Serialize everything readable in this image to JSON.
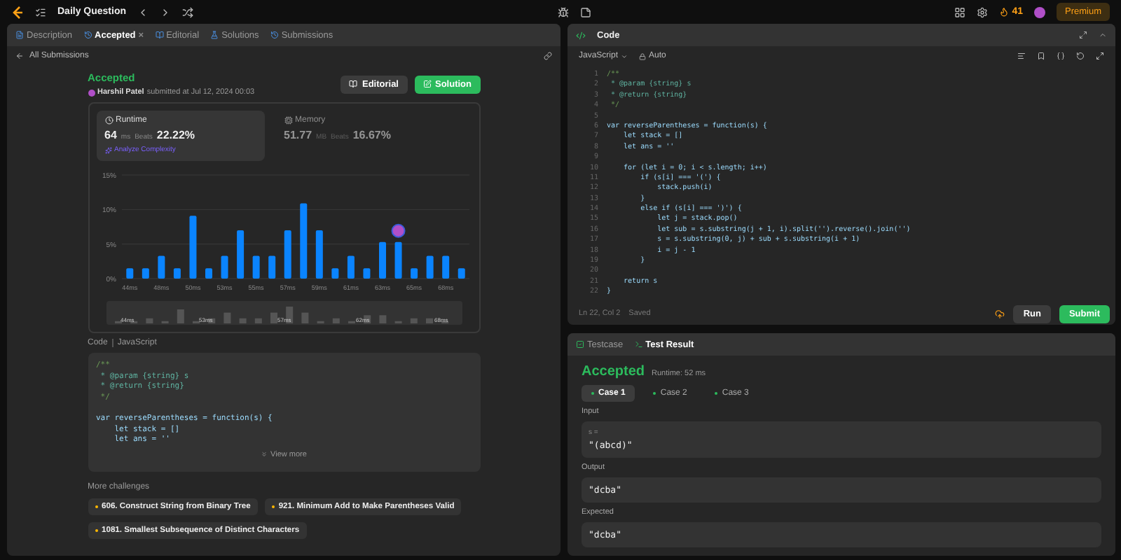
{
  "top_bar": {
    "title": "Daily Question",
    "streak": "41",
    "premium": "Premium"
  },
  "left_tabs": [
    {
      "label": "Description",
      "selected": false,
      "kind": "description"
    },
    {
      "label": "Accepted",
      "selected": true,
      "kind": "accepted",
      "close": "×"
    },
    {
      "label": "Editorial",
      "selected": false,
      "kind": "editorial"
    },
    {
      "label": "Solutions",
      "selected": false,
      "kind": "solutions"
    },
    {
      "label": "Submissions",
      "selected": false,
      "kind": "submissions"
    }
  ],
  "back_link": "All Submissions",
  "submission": {
    "status": "Accepted",
    "user": "Harshil Patel",
    "submitted": "submitted at Jul 12, 2024 00:03",
    "buttons": [
      {
        "label": "Editorial",
        "kind": "editorial"
      },
      {
        "label": "Solution",
        "kind": "solution"
      }
    ]
  },
  "metrics": [
    {
      "title": "Runtime",
      "kind": "runtime",
      "selected": true,
      "value": "64",
      "unit": "ms",
      "beats_label": "Beats",
      "beats": "22.22%",
      "link": "Analyze Complexity"
    },
    {
      "title": "Memory",
      "kind": "memory",
      "selected": false,
      "value": "51.77",
      "unit": "MB",
      "beats_label": "Beats",
      "beats": "16.67%"
    }
  ],
  "chart_data": {
    "type": "bar",
    "categories": [
      "44ms",
      null,
      "48ms",
      null,
      "50ms",
      null,
      "53ms",
      null,
      "55ms",
      null,
      "57ms",
      null,
      "59ms",
      null,
      "61ms",
      null,
      "63ms",
      null,
      "65ms",
      null,
      "68ms",
      null
    ],
    "series": [
      {
        "color": "#0a84ff",
        "values": [
          1.5,
          1.5,
          3.3,
          1.5,
          9.1,
          1.5,
          3.3,
          7,
          3.3,
          3.3,
          7,
          10.9,
          7,
          1.5,
          3.3,
          1.5,
          5.3,
          5.3,
          1.5,
          3.3,
          3.3,
          1.5
        ]
      }
    ],
    "ylim": [
      0,
      15
    ],
    "yticks": [
      {
        "value": 0,
        "label": "0%"
      },
      {
        "value": 5,
        "label": "5%"
      },
      {
        "value": 10,
        "label": "10%"
      },
      {
        "value": 15,
        "label": "15%"
      }
    ]
  },
  "overview_labels": [
    "44ms",
    "53ms",
    "57ms",
    "62ms",
    "68ms"
  ],
  "code_preview": {
    "label": "Code",
    "language": "JavaScript",
    "view_more": "View more",
    "lines": [
      {
        "text": "/**",
        "kind": "comment"
      },
      {
        "text": " * @param {string} s",
        "kind": "doc"
      },
      {
        "text": " * @return {string}",
        "kind": "doc"
      },
      {
        "text": " */",
        "kind": "comment"
      },
      {
        "kind": "blank"
      },
      {
        "text": "var reverseParentheses = function(s) {",
        "kind": "code"
      },
      {
        "text": "    let stack = []",
        "kind": "code"
      },
      {
        "text": "    let ans = ''",
        "kind": "code"
      }
    ]
  },
  "more_challenges": {
    "title": "More challenges",
    "items": [
      "606. Construct String from Binary Tree",
      "921. Minimum Add to Make Parentheses Valid",
      "1081. Smallest Subsequence of Distinct Characters"
    ]
  },
  "editor": {
    "title": "Code",
    "language": "JavaScript",
    "mode": "Auto",
    "cursor": "Ln 22, Col 2",
    "saved": "Saved",
    "run": "Run",
    "submit": "Submit",
    "lines": [
      {
        "number": "1",
        "text": "/**",
        "kind": "comment"
      },
      {
        "number": "2",
        "text": " * @param {string} s",
        "kind": "doc"
      },
      {
        "number": "3",
        "text": " * @return {string}",
        "kind": "doc"
      },
      {
        "number": "4",
        "text": " */",
        "kind": "comment"
      },
      {
        "number": "5",
        "kind": "blank"
      },
      {
        "number": "6",
        "text": "var reverseParentheses = function(s) {",
        "kind": "code"
      },
      {
        "number": "7",
        "text": "    let stack = []",
        "kind": "code"
      },
      {
        "number": "8",
        "text": "    let ans = ''",
        "kind": "code"
      },
      {
        "number": "9",
        "kind": "blank"
      },
      {
        "number": "10",
        "text": "    for (let i = 0; i < s.length; i++)",
        "kind": "code"
      },
      {
        "number": "11",
        "text": "        if (s[i] === '(') {",
        "kind": "code"
      },
      {
        "number": "12",
        "text": "            stack.push(i)",
        "kind": "code"
      },
      {
        "number": "13",
        "text": "        }",
        "kind": "code"
      },
      {
        "number": "14",
        "text": "        else if (s[i] === ')') {",
        "kind": "code"
      },
      {
        "number": "15",
        "text": "            let j = stack.pop()",
        "kind": "code"
      },
      {
        "number": "16",
        "text": "            let sub = s.substring(j + 1, i).split('').reverse().join('')",
        "kind": "code"
      },
      {
        "number": "17",
        "text": "            s = s.substring(0, j) + sub + s.substring(i + 1)",
        "kind": "code"
      },
      {
        "number": "18",
        "text": "            i = j - 1",
        "kind": "code"
      },
      {
        "number": "19",
        "text": "        }",
        "kind": "code"
      },
      {
        "number": "20",
        "kind": "blank"
      },
      {
        "number": "21",
        "text": "    return s",
        "kind": "code"
      },
      {
        "number": "22",
        "text": "}",
        "kind": "code"
      }
    ]
  },
  "result_tabs": [
    {
      "label": "Testcase",
      "selected": false,
      "kind": "testcase"
    },
    {
      "label": "Test Result",
      "selected": true,
      "kind": "result"
    }
  ],
  "result": {
    "status": "Accepted",
    "runtime": "Runtime: 52 ms",
    "cases": [
      {
        "label": "Case 1",
        "selected": true
      },
      {
        "label": "Case 2",
        "selected": false
      },
      {
        "label": "Case 3",
        "selected": false
      }
    ],
    "sections": [
      {
        "label": "Input",
        "var": "s =",
        "value": "\"(abcd)\""
      },
      {
        "label": "Output",
        "value": "\"dcba\""
      },
      {
        "label": "Expected",
        "value": "\"dcba\""
      }
    ]
  }
}
